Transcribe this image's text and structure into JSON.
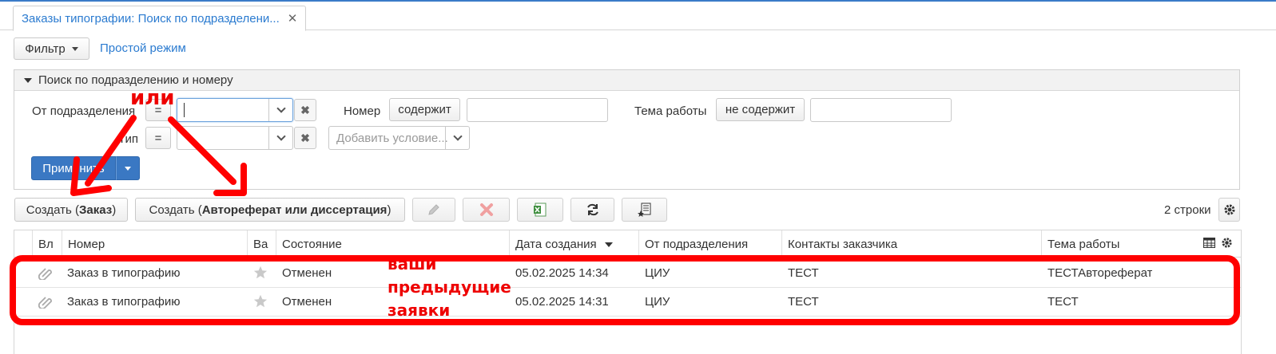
{
  "tab": {
    "title": "Заказы типографии: Поиск по подразделени...",
    "close": "✕"
  },
  "toolbar": {
    "filter_label": "Фильтр",
    "simple_mode_label": "Простой режим"
  },
  "search_panel": {
    "title": "Поиск по подразделению и номеру",
    "from_division_label": "От подразделения",
    "from_division_op": "=",
    "type_label": "Тип",
    "type_op": "=",
    "number_label": "Номер",
    "number_op": "содержит",
    "topic_label": "Тема работы",
    "topic_op": "не содержит",
    "add_condition_placeholder": "Добавить условие...",
    "apply_label": "Применить"
  },
  "actions": {
    "create_order_prefix": "Создать (",
    "create_order_bold": "Заказ",
    "create_order_suffix": ")",
    "create_thesis_prefix": "Создать (",
    "create_thesis_bold": "Автореферат или диссертация",
    "create_thesis_suffix": ")",
    "row_count": "2 строки"
  },
  "grid": {
    "columns": [
      "Вл",
      "Номер",
      "Ва",
      "Состояние",
      "Дата создания",
      "От подразделения",
      "Контакты заказчика",
      "Тема работы"
    ],
    "rows": [
      {
        "number": "Заказ в типографию",
        "state": "Отменен",
        "created": "05.02.2025 14:34",
        "division": "ЦИУ",
        "contacts": "ТЕСТ",
        "topic": "ТЕСТАвтореферат"
      },
      {
        "number": "Заказ в типографию",
        "state": "Отменен",
        "created": "05.02.2025 14:31",
        "division": "ЦИУ",
        "contacts": "ТЕСТ",
        "topic": "ТЕСТ"
      }
    ]
  },
  "annotations": {
    "or_label": "или",
    "prev_requests_line1": "ваши",
    "prev_requests_line2": "предыдущие",
    "prev_requests_line3": "заявки"
  },
  "colors": {
    "accent": "#2b7bd0",
    "primary": "#3a78c3",
    "annotation": "#ff0000"
  }
}
